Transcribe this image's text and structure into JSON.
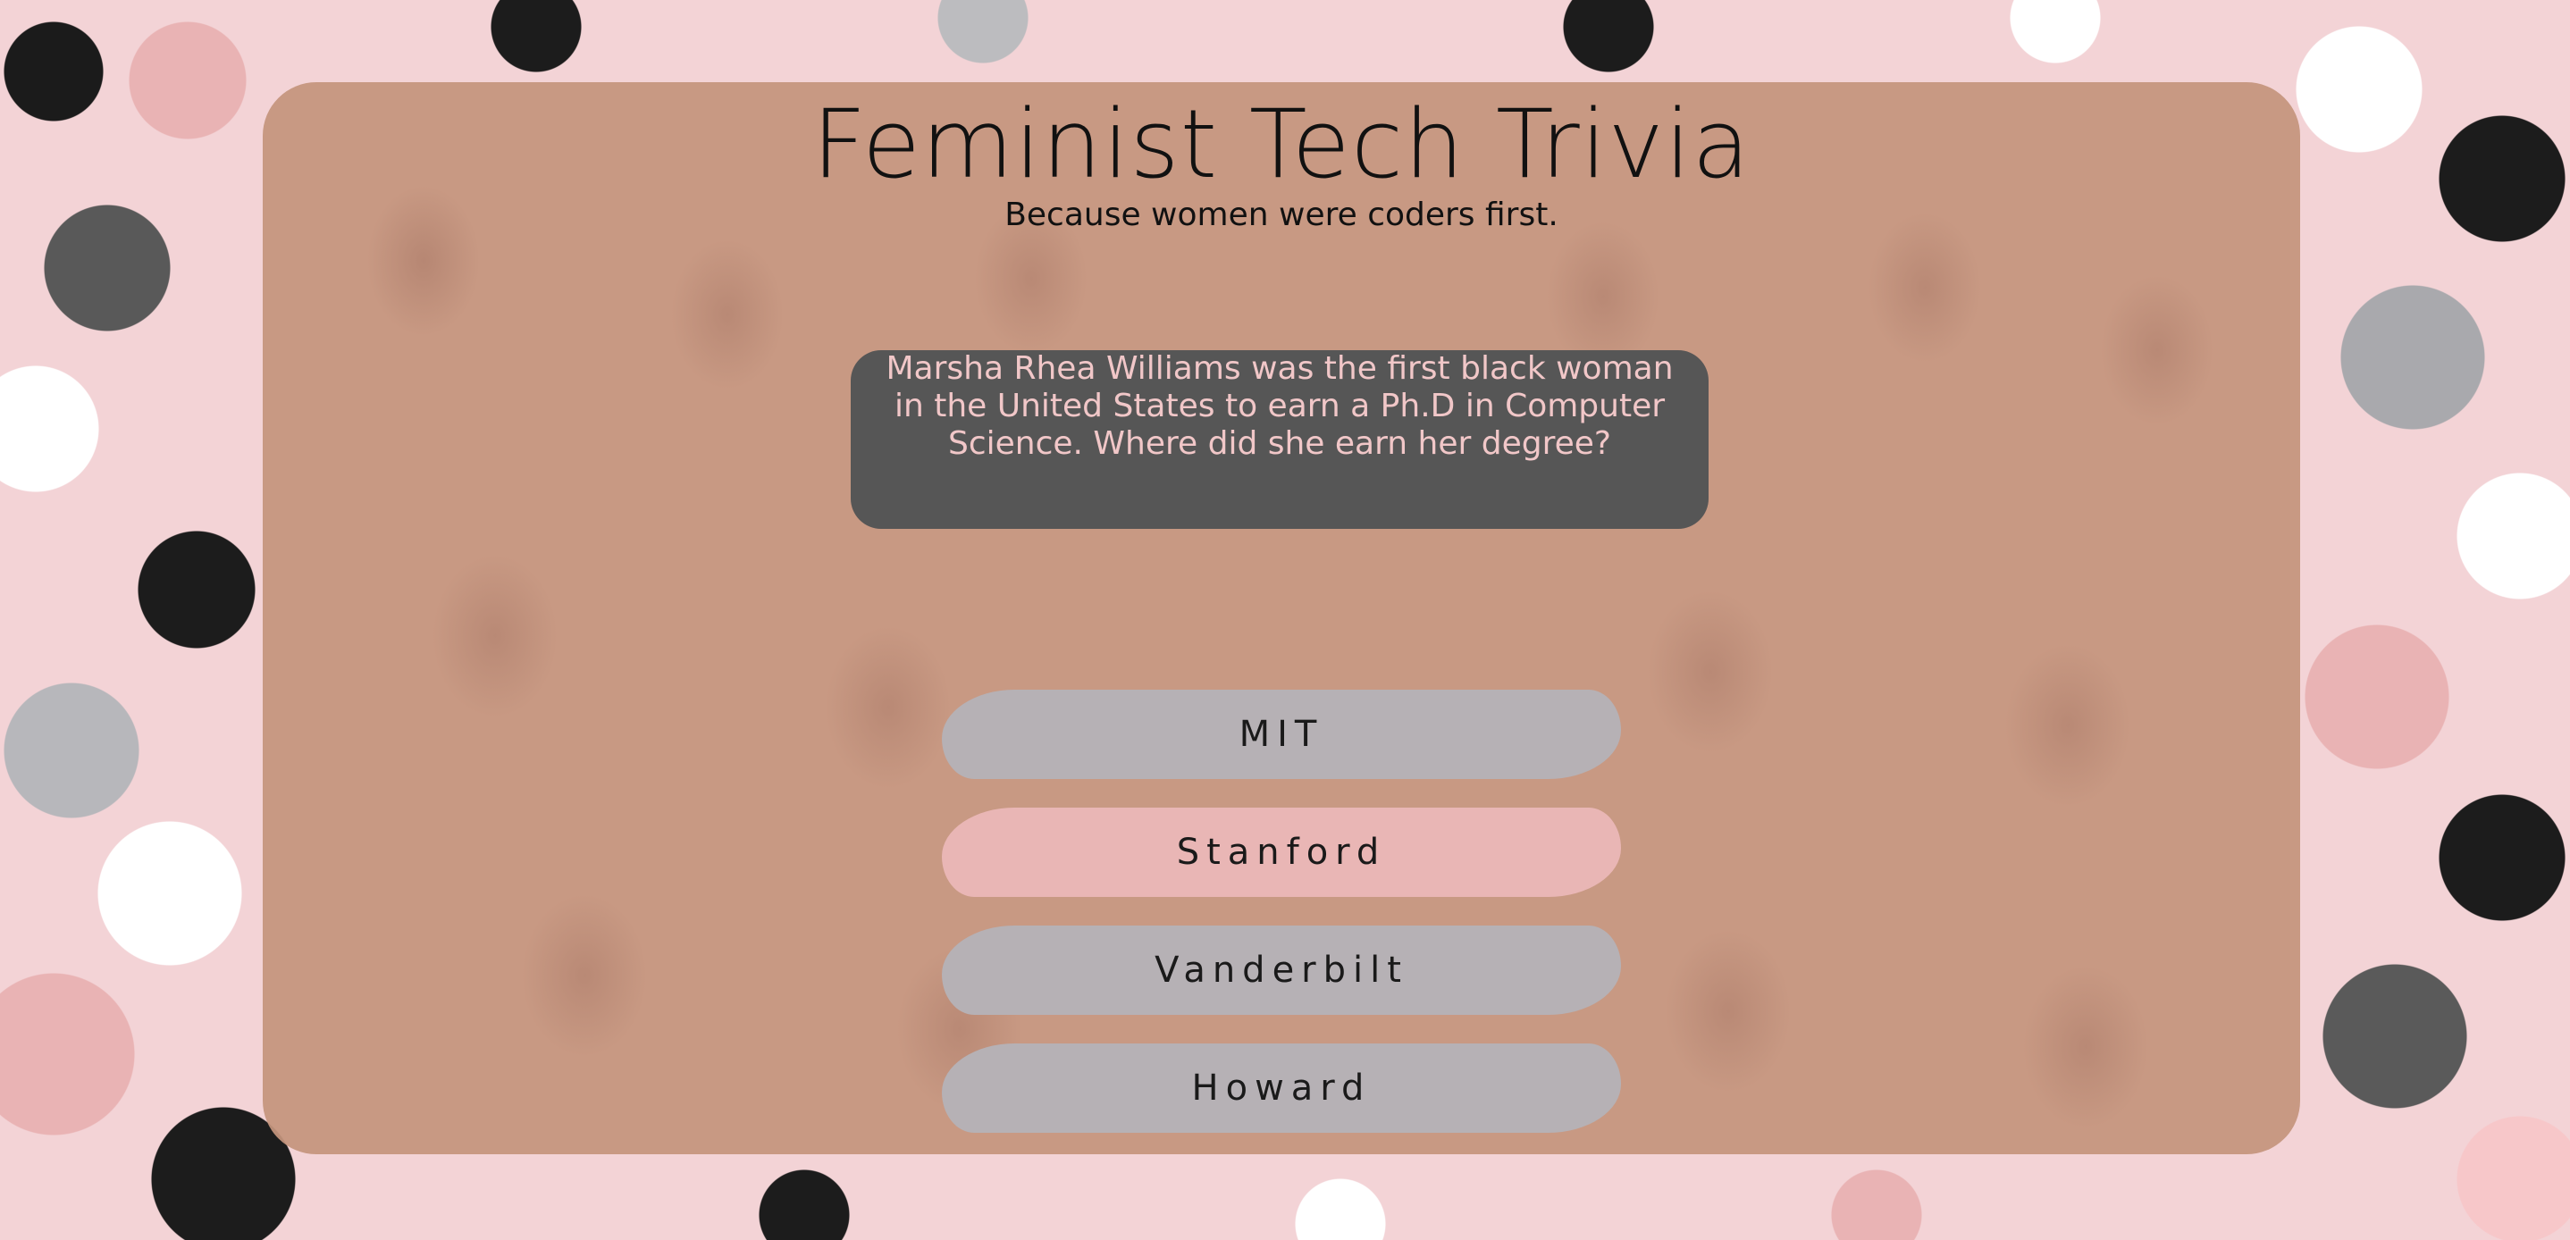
{
  "header": {
    "title": "Feminist Tech Trivia",
    "subtitle": "Because women were coders first."
  },
  "question": {
    "text": "Marsha Rhea Williams was the first black woman in the United States to earn a Ph.D in Computer Science. Where did she earn her degree?"
  },
  "answers": [
    {
      "label": "MIT",
      "selected": false
    },
    {
      "label": "Stanford",
      "selected": true
    },
    {
      "label": "Vanderbilt",
      "selected": false
    },
    {
      "label": "Howard",
      "selected": false
    }
  ],
  "colors": {
    "card": "#c4947d",
    "question_bg": "#565656",
    "question_text": "#f1c7c8",
    "answer_default": "#b6b1b5",
    "answer_selected": "#e9b6b5"
  }
}
